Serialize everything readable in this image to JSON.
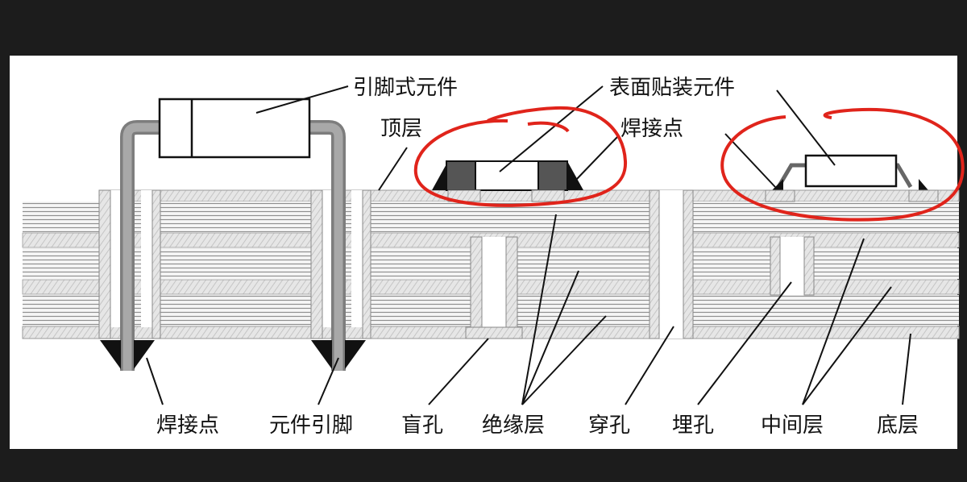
{
  "labels": {
    "through_hole_component": "引脚式元件",
    "smd_component": "表面贴装元件",
    "top_layer": "顶层",
    "solder_joint_top": "焊接点",
    "solder_joint_bottom": "焊接点",
    "component_lead": "元件引脚",
    "blind_via": "盲孔",
    "insulation_layer": "绝缘层",
    "through_via": "穿孔",
    "buried_via": "埋孔",
    "middle_layer": "中间层",
    "bottom_layer": "底层"
  },
  "colors": {
    "background": "#1c1c1c",
    "paper": "#ffffff",
    "annotation_circle": "#e0241b",
    "copper": "#b3b3b3",
    "lead": "#8c8c8c",
    "solder": "#1a1a1a"
  }
}
